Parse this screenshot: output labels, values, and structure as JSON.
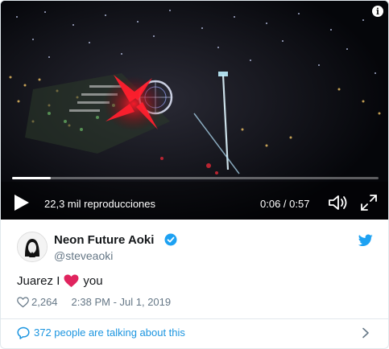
{
  "video": {
    "views": "22,3 mil reproducciones",
    "time_current": "0:06",
    "time_total": "0:57",
    "timecode": "0:06 / 0:57",
    "progress_fraction": 0.105
  },
  "tweet": {
    "author_name": "Neon Future Aoki",
    "handle": "@steveaoki",
    "verified": true,
    "text_before": "Juarez I",
    "emoji": "red-heart",
    "text_after": "you",
    "likes": "2,264",
    "timestamp": "2:38 PM - Jul 1, 2019",
    "talking": "372 people are talking about this"
  },
  "colors": {
    "twitter_blue": "#1da1f2",
    "link_blue": "#1b95e0",
    "heart_red": "#e0245e",
    "muted_text": "#657786",
    "primary_text": "#14171a"
  },
  "icons": {
    "info": "info-icon",
    "play": "play-icon",
    "volume": "volume-icon",
    "fullscreen": "fullscreen-icon",
    "verified": "verified-badge-icon",
    "twitter_bird": "twitter-bird-icon",
    "like": "heart-outline-icon",
    "comment": "comment-bubble-icon",
    "chevron": "chevron-right-icon"
  }
}
